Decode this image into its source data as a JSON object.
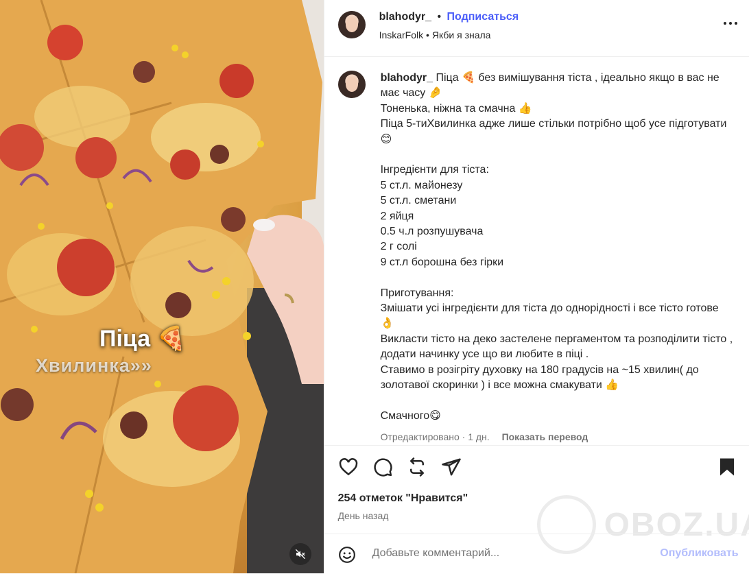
{
  "media": {
    "overlay_title": "Піца 🍕",
    "overlay_subtitle": "Хвилинка»»",
    "mute_icon": "speaker-muted-icon"
  },
  "header": {
    "username": "blahodyr_",
    "separator": "•",
    "follow_label": "Подписаться",
    "music_artist": "InskarFolk",
    "music_separator": "•",
    "music_title": "Якби я знала",
    "more_icon": "more-horizontal-icon"
  },
  "caption": {
    "username": "blahodyr_",
    "lines": [
      "Піца 🍕 без вимішування тіста , ідеально якщо в вас не має часу 🤌",
      "Тоненька, ніжна та смачна 👍",
      "Піца 5-тиХвилинка адже лише стільки потрібно щоб усе підготувати 😊",
      "",
      "Інгредієнти для тіста:",
      "5 ст.л. майонезу",
      "5 ст.л. сметани",
      "2 яйця",
      "0.5 ч.л розпушувача",
      "2 г солі",
      "9 ст.л борошна без гірки",
      "",
      "Приготування:",
      "Змішати усі інгредієнти для тіста до однорідності і все тісто готове 👌",
      "Викласти тісто на деко застелене пергаментом та розподілити тісто , додати начинку усе що ви любите в піці .",
      "Ставимо в розігріту духовку на 180 градусів на ~15 хвилин( до золотавої скоринки ) і все можна смакувати 👍",
      "",
      "Смачного😋"
    ],
    "edited": "Отредактировано · 1 дн.",
    "translate_label": "Показать перевод"
  },
  "actions": {
    "like_icon": "heart-icon",
    "comment_icon": "comment-icon",
    "repost_icon": "repost-icon",
    "share_icon": "send-icon",
    "save_icon": "bookmark-icon"
  },
  "likes_text": "254 отметок \"Нравится\"",
  "time_text": "День назад",
  "comment": {
    "emoji_icon": "emoji-smile-icon",
    "placeholder": "Добавьте комментарий...",
    "publish_label": "Опубликовать"
  },
  "watermark": {
    "text": "OBOZ.UA"
  },
  "colors": {
    "accent_blue": "#4a5df9",
    "publish_disabled": "#b3bdfc",
    "text_primary": "#262626",
    "text_secondary": "#737373"
  }
}
